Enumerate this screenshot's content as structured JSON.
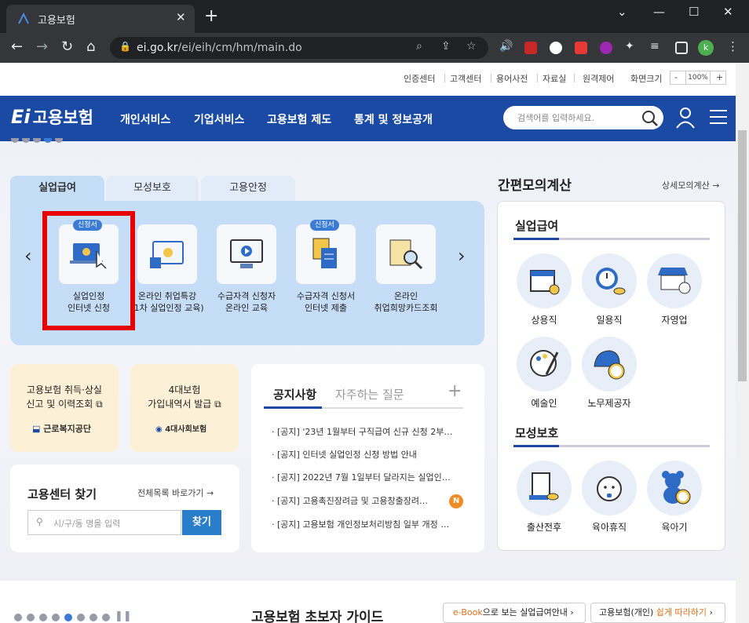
{
  "browser": {
    "tab_title": "고용보험",
    "url_domain": "ei.go.kr",
    "url_path": "/ei/eih/cm/hm/main.do",
    "profile_initial": "k"
  },
  "utility": {
    "links": [
      "인증센터",
      "고객센터",
      "용어사전",
      "자료실",
      "원격제어",
      "화면크기"
    ],
    "zoom": "100%",
    "zoom_minus": "-",
    "zoom_plus": "+"
  },
  "header": {
    "logo": "고용보험",
    "menu": [
      "개인서비스",
      "기업서비스",
      "고용보험 제도",
      "통계 및 정보공개"
    ],
    "search_placeholder": "검색어를 입력하세요."
  },
  "tabs": [
    "실업급여",
    "모성보호",
    "고용안정"
  ],
  "services": [
    {
      "label1": "실업인정",
      "label2": "인터넷 신청",
      "badge": "신청서"
    },
    {
      "label1": "온라인 취업특강",
      "label2": "(1차 실업인정 교육)",
      "badge": ""
    },
    {
      "label1": "수급자격 신청자",
      "label2": "온라인 교육",
      "badge": ""
    },
    {
      "label1": "수급자격 신청서",
      "label2": "인터넷 제출",
      "badge": "신청서"
    },
    {
      "label1": "온라인",
      "label2": "취업희망카드조회",
      "badge": ""
    }
  ],
  "cards": {
    "c1_line1": "고용보험 취득·상실",
    "c1_line2": "신고 및 이력조회",
    "c1_org": "근로복지공단",
    "c2_line1": "4대보험",
    "c2_line2": "가입내역서 발급",
    "c2_org": "4대사회보험"
  },
  "center": {
    "title": "고용센터 찾기",
    "link": "전체목록 바로가기",
    "placeholder": "시/구/동 명을 입력",
    "button": "찾기"
  },
  "notice": {
    "tab1": "공지사항",
    "tab2": "자주하는 질문",
    "more": "+",
    "items": [
      "[공지] '23년 1월부터 구직급여 신규 신청 2부…",
      "[공지] 인터넷 실업인정 신청 방법 안내",
      "[공지] 2022년 7월 1일부터 달라지는 실업인…",
      "[공지] 고용촉진장려금 및 고용창출장려…",
      "[공지] 고용보험 개인정보처리방침 일부 개정 …"
    ],
    "new_badge": "N"
  },
  "calc": {
    "title": "간편모의계산",
    "detail": "상세모의계산",
    "section1": "실업급여",
    "items1": [
      "상용직",
      "일용직",
      "자영업",
      "예술인",
      "노무제공자"
    ],
    "section2": "모성보호",
    "items2": [
      "출산전후",
      "육아휴직",
      "육아기"
    ]
  },
  "bottom": {
    "guide_title": "고용보험 초보자 가이드",
    "ebook_prefix": "e-Book",
    "ebook_text": "으로 보는 실업급여안내",
    "easy_prefix": "고용보험(개인)",
    "easy_text": " 쉽게 따라하기"
  },
  "colors": {
    "brand_blue": "#1a4aa3",
    "panel_blue": "#c5ddf6",
    "highlight_red": "#e60000"
  }
}
